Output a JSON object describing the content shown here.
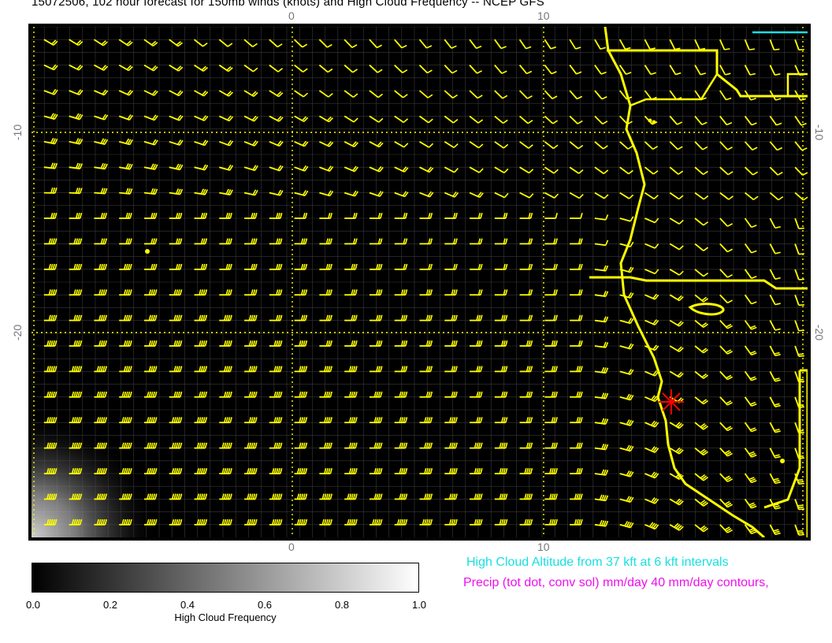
{
  "title": "15072506, 102 hour forecast for 150mb winds (knots) and High Cloud Frequency -- NCEP GFS",
  "map": {
    "lon_labels": [
      "0",
      "10"
    ],
    "lat_labels": [
      "-10",
      "-20"
    ],
    "lon_range": [
      -10.5,
      20.5
    ],
    "lat_range": [
      -30,
      -5
    ],
    "colors": {
      "background": "#000000",
      "grid": "#3a3a3a",
      "gridline_dotted": "#ffff00",
      "coastline": "#ffff00",
      "barbs": "#ffff00",
      "marker": "#ff0000",
      "cyan_contour": "#18e0e0"
    },
    "marker_icon": "asterisk-star-icon"
  },
  "colorbar": {
    "title": "High Cloud Frequency",
    "ticks": [
      "0.0",
      "0.2",
      "0.4",
      "0.6",
      "0.8",
      "1.0"
    ],
    "range": [
      0,
      1
    ]
  },
  "legend": {
    "cloud_altitude": "High Cloud Altitude from 37 kft at 6 kft intervals",
    "precip": "Precip (tot dot, conv sol) mm/day 40 mm/day contours,"
  }
}
